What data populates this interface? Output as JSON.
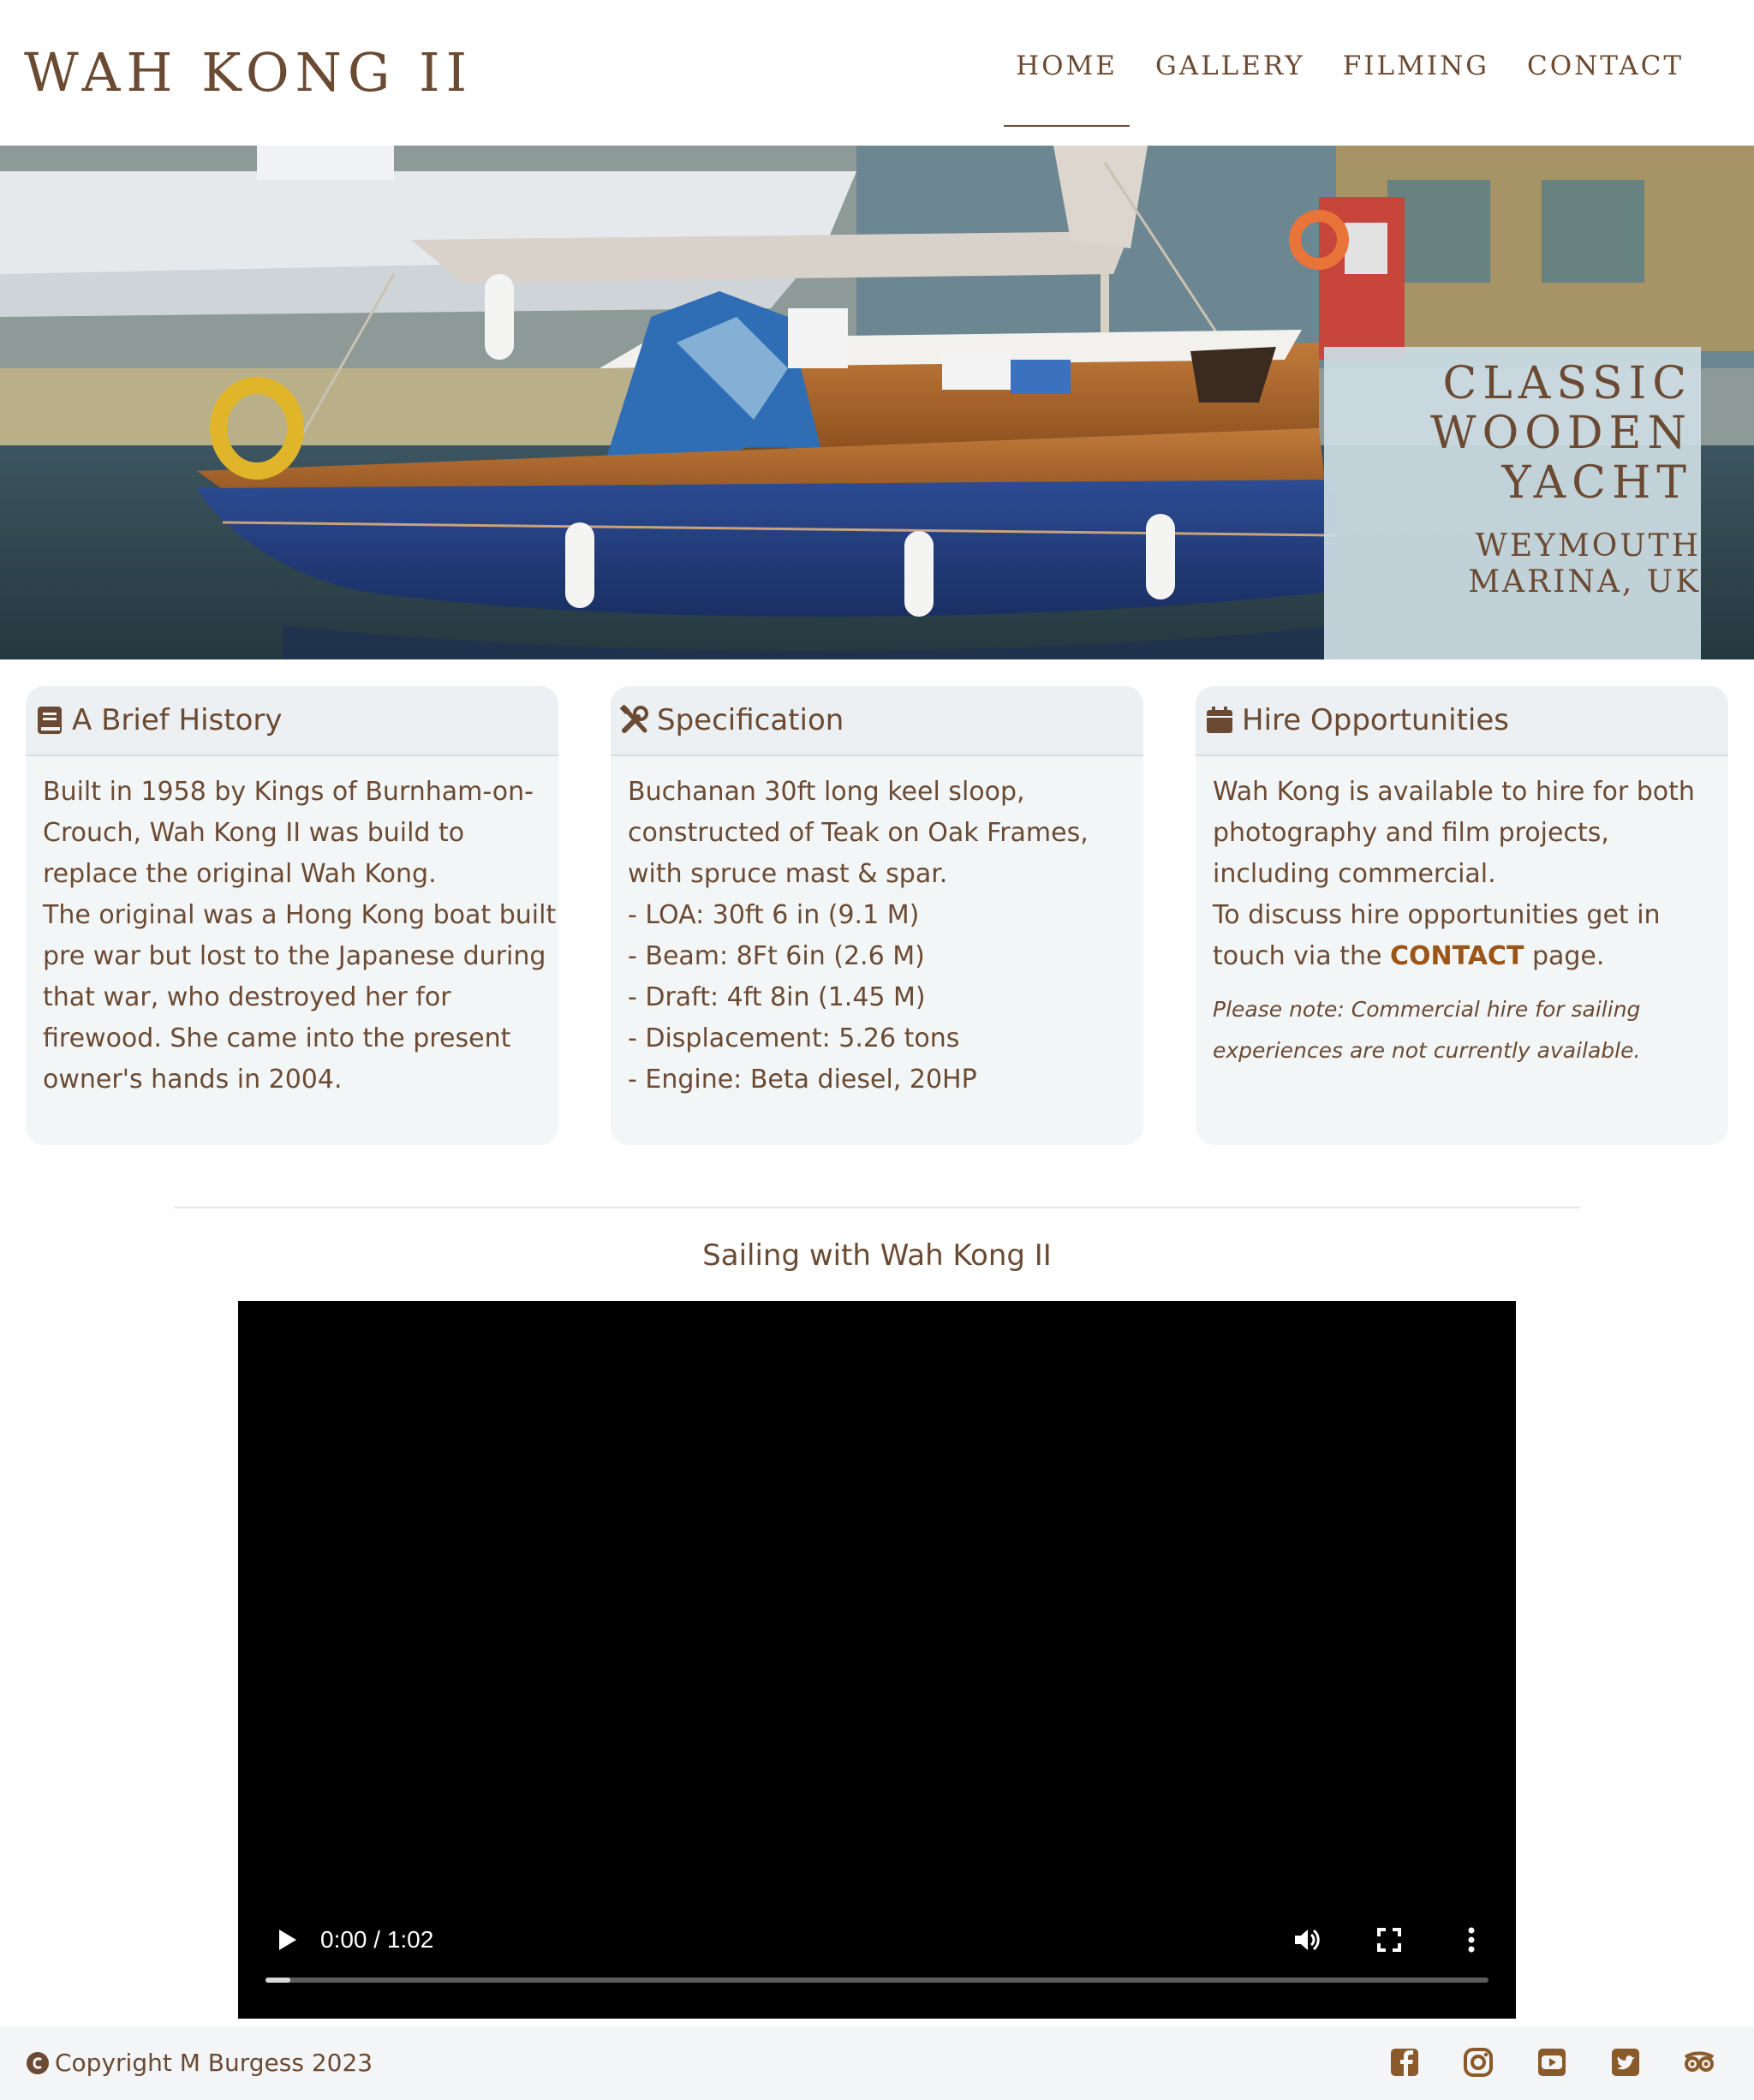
{
  "header": {
    "logo": "WAH KONG II",
    "nav": [
      "HOME",
      "GALLERY",
      "FILMING",
      "CONTACT"
    ],
    "active_nav": "HOME"
  },
  "hero": {
    "title": "CLASSIC\nWOODEN\nYACHT",
    "subtitle": "WEYMOUTH\nMARINA, UK"
  },
  "cards": {
    "history": {
      "icon": "book-icon",
      "title": "A Brief History",
      "lines": [
        "Built in 1958 by Kings of Burnham-on-",
        "Crouch, Wah Kong II was build to",
        "replace the original Wah Kong.",
        "The original was a Hong Kong boat built",
        "pre war but lost to the Japanese during",
        "that war, who destroyed her for",
        "firewood. She came into the present",
        "owner's hands in 2004."
      ]
    },
    "spec": {
      "icon": "tools-icon",
      "title": "Specification",
      "lines": [
        "Buchanan 30ft long keel sloop,",
        "constructed of Teak on Oak Frames,",
        "with spruce mast & spar.",
        "- LOA: 30ft 6 in (9.1 M)",
        "- Beam: 8Ft 6in (2.6 M)",
        "- Draft: 4ft 8in (1.45 M)",
        "- Displacement: 5.26 tons",
        "- Engine: Beta diesel, 20HP"
      ]
    },
    "hire": {
      "icon": "calendar-icon",
      "title": "Hire Opportunities",
      "lines": [
        "Wah Kong is available to hire for both",
        "photography and film projects,",
        "including commercial.",
        "To discuss hire opportunities get in"
      ],
      "last_line_pre": "touch via the ",
      "link": "CONTACT",
      "last_line_post": " page.",
      "note_lines": [
        "Please note: Commercial hire for sailing",
        "experiences are not currently available."
      ]
    }
  },
  "video": {
    "title": "Sailing with Wah Kong II",
    "time": "0:00 / 1:02",
    "progress_fraction": 0.02
  },
  "footer": {
    "copyright": "Copyright M Burgess 2023",
    "social": [
      "facebook-icon",
      "instagram-icon",
      "youtube-icon",
      "twitter-icon",
      "tripadvisor-icon"
    ]
  },
  "colors": {
    "text": "#6b4a33",
    "link": "#9a5518",
    "card_bg": "#f3f6f7",
    "hull_blue": "#23407e"
  }
}
